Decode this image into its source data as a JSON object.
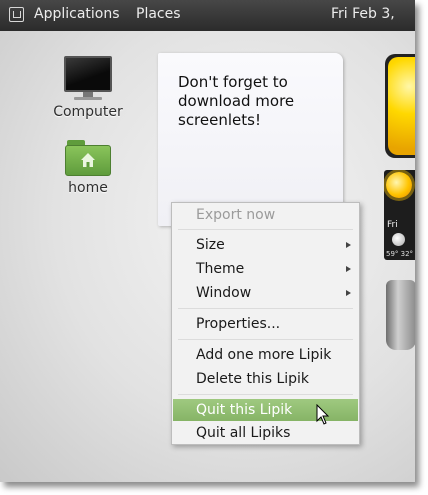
{
  "panel": {
    "menus": [
      "Applications",
      "Places"
    ],
    "clock": "Fri Feb  3,"
  },
  "desktop": {
    "icons": [
      {
        "label": "Computer",
        "icon": "computer-icon"
      },
      {
        "label": "home",
        "icon": "home-folder-icon"
      }
    ]
  },
  "note": {
    "text": "Don't forget to download more screenlets!"
  },
  "weather": {
    "day": "Fri",
    "temp": "59° 32°"
  },
  "context_menu": {
    "items": [
      {
        "label": "Export now",
        "state": "disabled"
      },
      {
        "label": "Size",
        "submenu": true
      },
      {
        "label": "Theme",
        "submenu": true
      },
      {
        "label": "Window",
        "submenu": true
      },
      {
        "label": "Properties..."
      },
      {
        "label": "Add one more Lipik"
      },
      {
        "label": "Delete this Lipik"
      },
      {
        "label": "Quit this Lipik",
        "state": "highlighted"
      },
      {
        "label": "Quit all Lipiks"
      }
    ]
  },
  "colors": {
    "panel": "#2b2b2b",
    "menu_highlight": "#86b466",
    "folder": "#5f9c3c"
  }
}
